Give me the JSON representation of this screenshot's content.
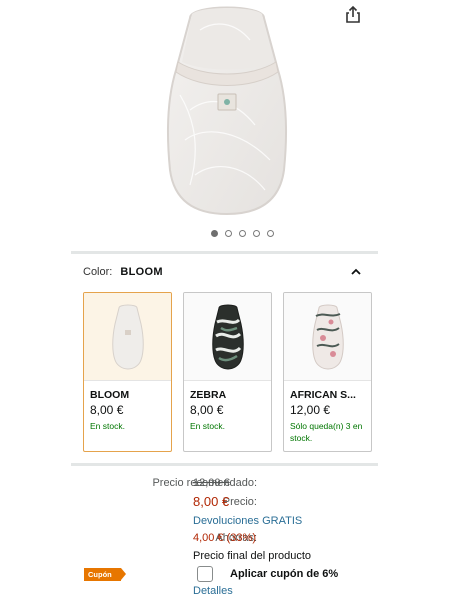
{
  "colors": {
    "selected_border": "#e5a34c",
    "price_red": "#b12704",
    "stock_green": "#007600",
    "link_blue": "#2a6e96",
    "coupon_orange": "#e77600"
  },
  "gallery": {
    "image_count": 5,
    "active_index": 0,
    "share_icon": "share-icon"
  },
  "variant": {
    "color_label": "Color:",
    "color_value": "BLOOM",
    "collapse_icon": "chevron-up-icon",
    "options": [
      {
        "name": "BLOOM",
        "price": "8,00 €",
        "stock": "En stock.",
        "selected": true
      },
      {
        "name": "ZEBRA",
        "price": "8,00 €",
        "stock": "En stock.",
        "selected": false
      },
      {
        "name": "AFRICAN S...",
        "price": "12,00 €",
        "stock": "Sólo queda(n) 3 en stock.",
        "selected": false
      }
    ]
  },
  "pricing": {
    "rrp_label": "Precio recomendado:",
    "rrp_value": "12,00 €",
    "price_label": "Precio:",
    "price_value": "8,00 €",
    "returns_link": "Devoluciones GRATIS",
    "savings_label": "Ahorras:",
    "savings_value": "4,00 € (33%)",
    "final_price_note": "Precio final del producto"
  },
  "coupon": {
    "badge": "Cupón",
    "text": "Aplicar cupón de 6%",
    "details_link": "Detalles"
  }
}
